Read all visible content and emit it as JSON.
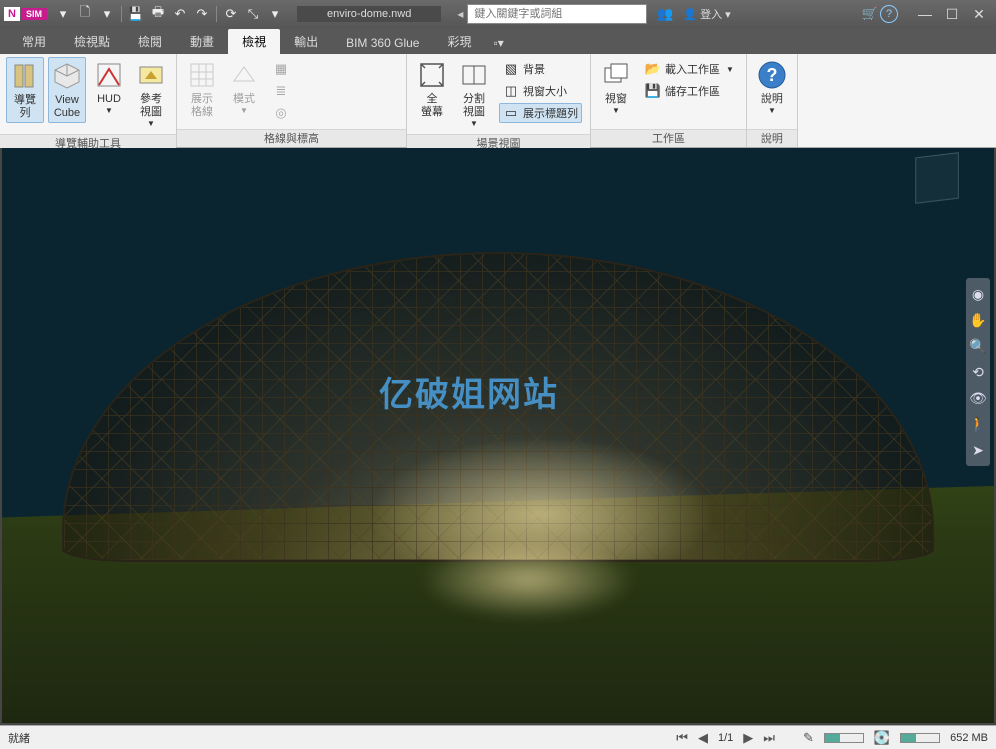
{
  "app": {
    "badge_n": "N",
    "badge_sim": "SIM",
    "filename": "enviro-dome.nwd"
  },
  "titlebar": {
    "search_placeholder": "鍵入關鍵字或詞組",
    "login": "登入"
  },
  "tabs": {
    "items": [
      "常用",
      "檢視點",
      "檢閱",
      "動畫",
      "檢視",
      "輸出",
      "BIM 360 Glue",
      "彩現"
    ],
    "active_index": 4
  },
  "ribbon": {
    "nav_aids": {
      "title": "導覽輔助工具",
      "nav_list": "導覽\n列",
      "view_cube": "View\nCube",
      "hud": "HUD",
      "ref_view": "參考\n視圖"
    },
    "grid_elev": {
      "title": "格線與標高",
      "show_grid": "展示\n格線",
      "mode": "模式"
    },
    "scene_view": {
      "title": "場景視圖",
      "fullscreen": "全\n螢幕",
      "split_view": "分割\n視圖",
      "background": "背景",
      "window_size": "視窗大小",
      "show_titlebar": "展示標題列"
    },
    "workspace": {
      "title": "工作區",
      "windows": "視窗",
      "load_workspace": "載入工作區",
      "save_workspace": "儲存工作區"
    },
    "help": {
      "title": "說明",
      "help_btn": "說明"
    }
  },
  "watermark": "亿破姐网站",
  "statusbar": {
    "ready": "就緒",
    "page": "1/1",
    "memory": "652 MB"
  }
}
